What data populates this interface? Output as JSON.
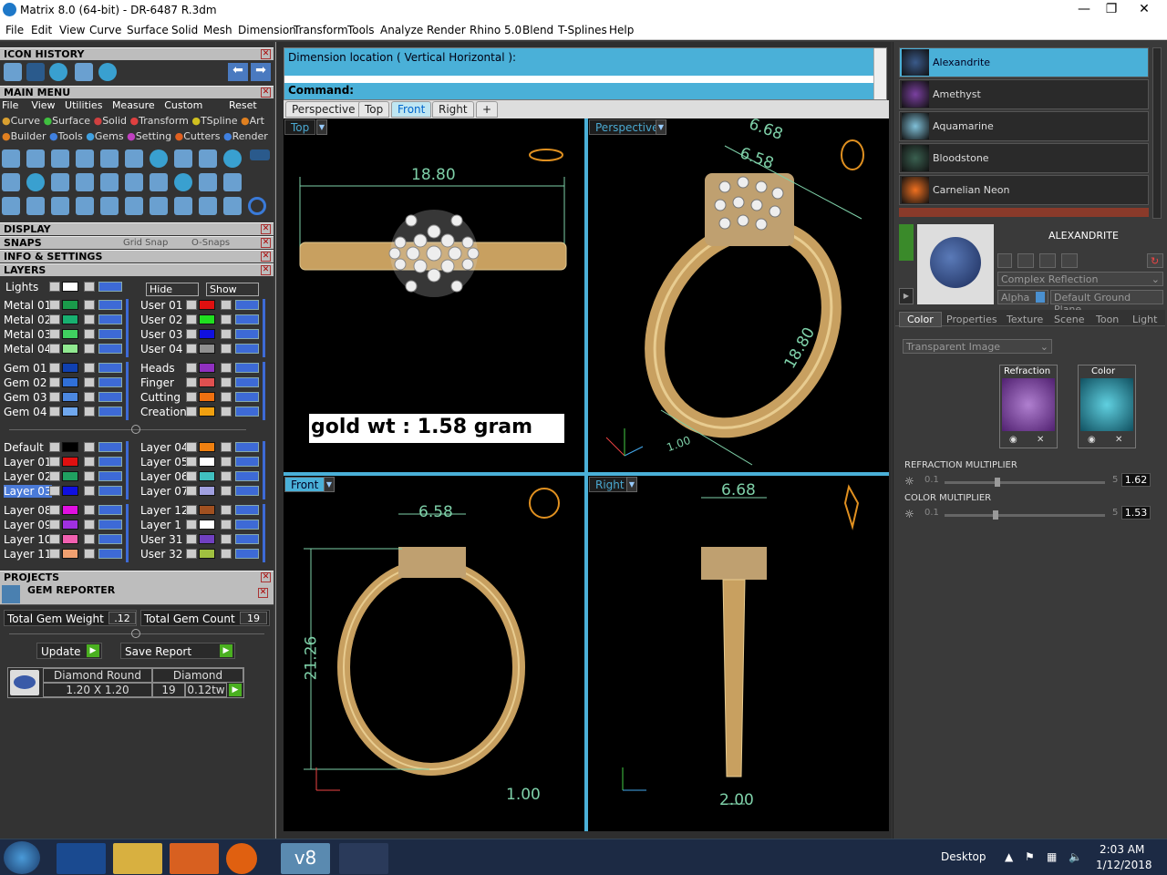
{
  "window": {
    "title": "Matrix 8.0 (64-bit) - DR-6487 R.3dm",
    "min": "—",
    "max": "❐",
    "close": "✕"
  },
  "menu": [
    "File",
    "Edit",
    "View",
    "Curve",
    "Surface",
    "Solid",
    "Mesh",
    "Dimension",
    "Transform",
    "Tools",
    "Analyze",
    "Render",
    "Rhino 5.0",
    "Blend",
    "T-Splines",
    "Help"
  ],
  "left": {
    "icon_history": "ICON HISTORY",
    "main_menu": "MAIN MENU",
    "main_menu_row1": [
      "File",
      "View",
      "Utilities",
      "Measure",
      "Custom",
      "Reset"
    ],
    "main_menu_row2": [
      "Curve",
      "Surface",
      "Solid",
      "Transform",
      "TSpline",
      "Art"
    ],
    "main_menu_row3": [
      "Builder",
      "Tools",
      "Gems",
      "Setting",
      "Cutters",
      "Render"
    ],
    "display": "DISPLAY",
    "snaps": "SNAPS",
    "grid_snap": "Grid Snap",
    "o_snaps": "O-Snaps",
    "info_settings": "INFO & SETTINGS",
    "layers": "LAYERS",
    "lights": "Lights",
    "hide": "Hide",
    "show": "Show",
    "layers_left": [
      {
        "name": "Metal 01",
        "color": "#1a9a4a"
      },
      {
        "name": "Metal 02",
        "color": "#18b070"
      },
      {
        "name": "Metal 03",
        "color": "#40d060"
      },
      {
        "name": "Metal 04",
        "color": "#90e890"
      },
      {
        "name": "Gem 01",
        "color": "#1040b0"
      },
      {
        "name": "Gem 02",
        "color": "#3070d8"
      },
      {
        "name": "Gem 03",
        "color": "#4c88e0"
      },
      {
        "name": "Gem 04",
        "color": "#70a8ee"
      },
      {
        "name": "Default",
        "color": "#000000"
      },
      {
        "name": "Layer 01",
        "color": "#e01010"
      },
      {
        "name": "Layer 02",
        "color": "#20a060"
      },
      {
        "name": "Layer 03",
        "color": "#1010e0"
      },
      {
        "name": "Layer 08",
        "color": "#e010e0"
      },
      {
        "name": "Layer 09",
        "color": "#a030e0"
      },
      {
        "name": "Layer 10",
        "color": "#f060b0"
      },
      {
        "name": "Layer 11",
        "color": "#f0a070"
      }
    ],
    "layers_right": [
      {
        "name": "User 01",
        "color": "#e01010"
      },
      {
        "name": "User 02",
        "color": "#20e020"
      },
      {
        "name": "User 03",
        "color": "#1010e0"
      },
      {
        "name": "User 04",
        "color": "#909090"
      },
      {
        "name": "Heads",
        "color": "#9030c0"
      },
      {
        "name": "Finger",
        "color": "#e05050"
      },
      {
        "name": "Cutting",
        "color": "#f07010"
      },
      {
        "name": "Creation",
        "color": "#f0a010"
      },
      {
        "name": "Layer 04",
        "color": "#f08010"
      },
      {
        "name": "Layer 05",
        "color": "#ffffff"
      },
      {
        "name": "Layer 06",
        "color": "#40c0c0"
      },
      {
        "name": "Layer 07",
        "color": "#a0a0e0"
      },
      {
        "name": "Layer 12",
        "color": "#a05020"
      },
      {
        "name": "Layer 1",
        "color": "#ffffff"
      },
      {
        "name": "User 31",
        "color": "#7040c0"
      },
      {
        "name": "User 32",
        "color": "#a0c040"
      }
    ],
    "projects": "PROJECTS",
    "gem_reporter": "GEM REPORTER",
    "total_gem_weight_label": "Total Gem Weight",
    "total_gem_weight": ".12",
    "total_gem_count_label": "Total Gem Count",
    "total_gem_count": "19",
    "update": "Update",
    "save_report": "Save Report",
    "gem_row": {
      "shape": "Diamond Round",
      "material": "Diamond",
      "size": "1.20 X 1.20",
      "count": "19",
      "tw": "0.12tw"
    }
  },
  "command": {
    "line1": "Dimension location ( Vertical  Horizontal ):",
    "line2": "Command:"
  },
  "view_tabs": [
    "Perspective",
    "Top",
    "Front",
    "Right",
    "+"
  ],
  "viewports": {
    "top": {
      "label": "Top",
      "dim": "18.80",
      "gold": "gold wt : 1.58 gram"
    },
    "perspective": {
      "label": "Perspective",
      "dim1": "6.68",
      "dim2": "6.58",
      "dim3": "18.80",
      "dim4": "1.00"
    },
    "front": {
      "label": "Front",
      "dim1": "6.58",
      "dim2": "21.26",
      "dim3": "1.00"
    },
    "right": {
      "label": "Right",
      "dim1": "6.68",
      "dim2": "2.00"
    }
  },
  "right": {
    "gems": [
      {
        "name": "Alexandrite",
        "color": "#3a5a8a"
      },
      {
        "name": "Amethyst",
        "color": "#7a40a0"
      },
      {
        "name": "Aquamarine",
        "color": "#80c0d8"
      },
      {
        "name": "Bloodstone",
        "color": "#3a6050"
      },
      {
        "name": "Carnelian Neon",
        "color": "#f07020"
      }
    ],
    "preview_title": "ALEXANDRITE",
    "material_mode": "Complex Reflection",
    "alpha": "Alpha",
    "ground": "Default Ground Plane",
    "tabs": [
      "Color",
      "Properties",
      "Texture",
      "Scene",
      "Toon",
      "Light"
    ],
    "transparent": "Transparent Image",
    "refraction": "Refraction",
    "color": "Color",
    "refraction_multiplier": "REFRACTION MULTIPLIER",
    "color_multiplier": "COLOR MULTIPLIER",
    "slider_min": "0.1",
    "slider_max": "5",
    "refraction_value": "1.62",
    "color_value": "1.53",
    "refraction_level": 0.31,
    "color_level": 0.3
  },
  "taskbar": {
    "desktop": "Desktop",
    "time": "2:03 AM",
    "date": "1/12/2018",
    "v8": "v8"
  }
}
